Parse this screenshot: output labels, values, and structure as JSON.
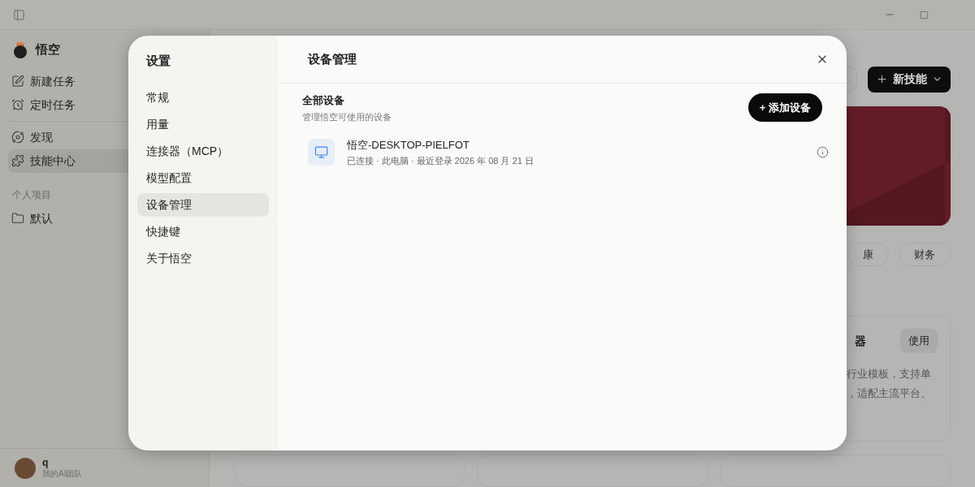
{
  "app": {
    "name": "悟空",
    "nav_groups": [
      {
        "items": [
          {
            "label": "新建任务",
            "selected": false
          },
          {
            "label": "定时任务",
            "selected": false
          }
        ]
      },
      {
        "items": [
          {
            "label": "发现",
            "selected": false
          },
          {
            "label": "技能中心",
            "selected": true
          }
        ]
      }
    ],
    "section": "个人项目",
    "projects": [
      {
        "label": "默认"
      }
    ],
    "user": {
      "name": "q",
      "team": "我的AI团队"
    }
  },
  "main": {
    "new_button": "新技能",
    "chips": [
      "康",
      "财务"
    ],
    "card": {
      "title": "器",
      "button": "使用",
      "description": [
        "行业模板，支持单",
        "，适配主流平台。"
      ]
    }
  },
  "dialog": {
    "title": "设置",
    "menu": [
      {
        "label": "常规",
        "selected": false
      },
      {
        "label": "用量",
        "selected": false
      },
      {
        "label": "连接器（MCP）",
        "selected": false
      },
      {
        "label": "模型配置",
        "selected": false
      },
      {
        "label": "设备管理",
        "selected": true
      },
      {
        "label": "快捷键",
        "selected": false
      },
      {
        "label": "关于悟空",
        "selected": false
      }
    ],
    "page_title": "设备管理",
    "section_title": "全部设备",
    "section_subtitle": "管理悟空可使用的设备",
    "add_button": "+ 添加设备",
    "devices": [
      {
        "name": "悟空-DESKTOP-PIELFOT",
        "status": "已连接 · 此电脑 · 最近登录 2026 年 08 月 21 日"
      }
    ]
  }
}
